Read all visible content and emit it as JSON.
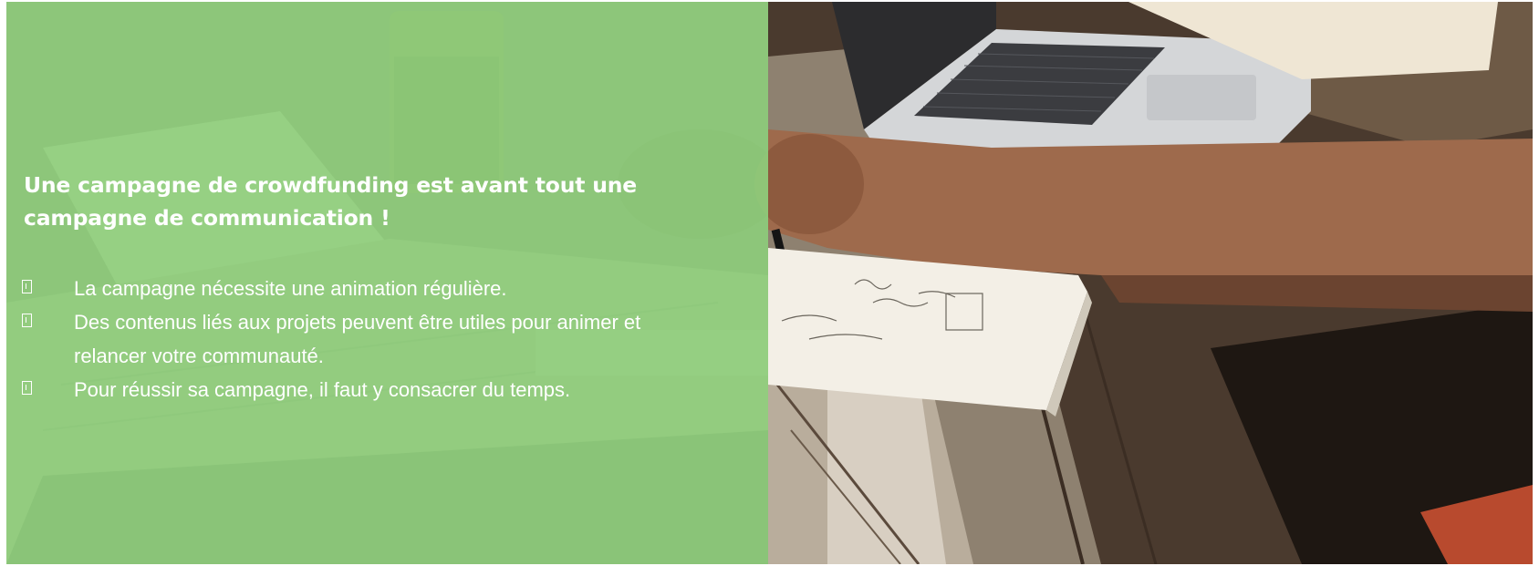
{
  "slide": {
    "headline_lines": [
      "Une campagne de crowdfunding est avant tout une",
      "campagne de communication !"
    ],
    "bullets": [
      "La campagne nécessite une animation régulière.",
      "Des contenus liés aux projets peuvent être utiles pour animer et",
      "relancer votre communauté.",
      "Pour réussir sa campagne, il faut y consacrer du temps."
    ]
  },
  "colors": {
    "overlay_green": "#8fce7c",
    "text": "#ffffff"
  },
  "icons": {
    "bullet": "missing-glyph-box-icon",
    "photo": "desk-laptop-notebook-photo"
  }
}
